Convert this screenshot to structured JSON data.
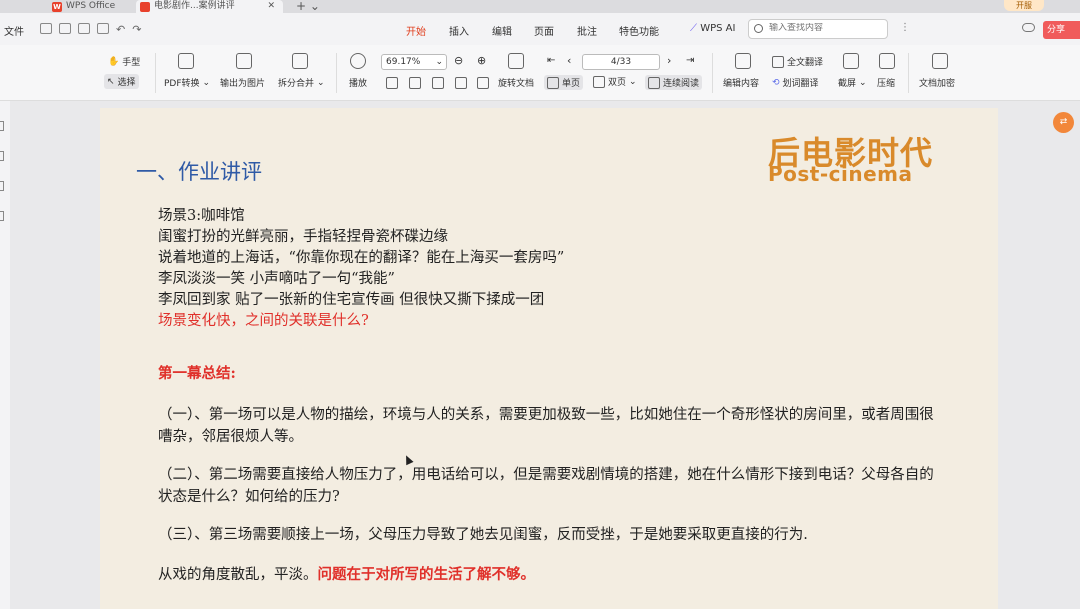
{
  "titlebar": {
    "app_tab": "WPS Office",
    "doc_tab": "电影剧作...案例讲评",
    "open_button": "开服"
  },
  "menu": {
    "file": "文件",
    "tabs": [
      "开始",
      "插入",
      "编辑",
      "页面",
      "批注",
      "特色功能"
    ],
    "active_tab": "开始",
    "wps_ai": "WPS AI",
    "search_placeholder": "输入查找内容",
    "share": "分享"
  },
  "ribbon": {
    "hand": "手型",
    "select": "选择",
    "pdf_convert": "PDF转换",
    "export_image": "输出为图片",
    "split_merge": "拆分合并",
    "play": "播放",
    "zoom": "69.17%",
    "page": "4/33",
    "rotate": "旋转文档",
    "single": "单页",
    "double": "双页",
    "continuous": "连续阅读",
    "edit_content": "编辑内容",
    "full_translate": "全文翻译",
    "word_translate": "划词翻译",
    "screenshot": "截屏",
    "compress": "压缩",
    "encrypt": "文档加密"
  },
  "page": {
    "brand_cn": "后电影时代",
    "brand_en": "Post-cinema",
    "heading": "一、作业讲评",
    "scene_lines": [
      "场景3:咖啡馆",
      "闺蜜打扮的光鲜亮丽，手指轻捏骨瓷杯碟边缘",
      "说着地道的上海话，“你靠你现在的翻译？能在上海买一套房吗”",
      "李凤淡淡一笑 小声嘀咕了一句“我能”",
      "李凤回到家 贴了一张新的住宅宣传画 但很快又撕下揉成一团"
    ],
    "scene_question": "场景变化快，之间的关联是什么?",
    "summary_title": "第一幕总结:",
    "para1": "（一）、第一场可以是人物的描绘，环境与人的关系，需要更加极致一些，比如她住在一个奇形怪状的房间里，或者周围很嘈杂，邻居很烦人等。",
    "para2": "（二）、第二场需要直接给人物压力了，用电话给可以，但是需要戏剧情境的搭建，她在什么情形下接到电话？父母各自的状态是什么？如何给的压力?",
    "para3": "（三）、第三场需要顺接上一场，父母压力导致了她去见闺蜜，反而受挫，于是她要采取更直接的行为.",
    "para4_plain": "从戏的角度散乱，平淡。",
    "para4_red": "问题在于对所写的生活了解不够。"
  },
  "colors": {
    "accent": "#e0401f",
    "heading_blue": "#2f5aa6",
    "brand_orange": "#d98a2b",
    "red_text": "#e0302a",
    "page_bg": "#f3ede1"
  }
}
